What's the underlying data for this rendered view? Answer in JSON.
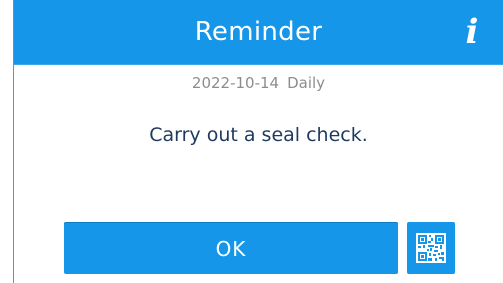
{
  "dialog": {
    "title": "Reminder",
    "info_icon": "info-icon",
    "date": "2022-10-14",
    "frequency": "Daily",
    "message": "Carry out a seal check.",
    "ok_label": "OK",
    "qr_icon": "qr-code-icon"
  },
  "colors": {
    "accent": "#1596e8",
    "header_text": "#ffffff",
    "meta_text": "#8d8d8d",
    "message_text": "#1e3a5f"
  }
}
